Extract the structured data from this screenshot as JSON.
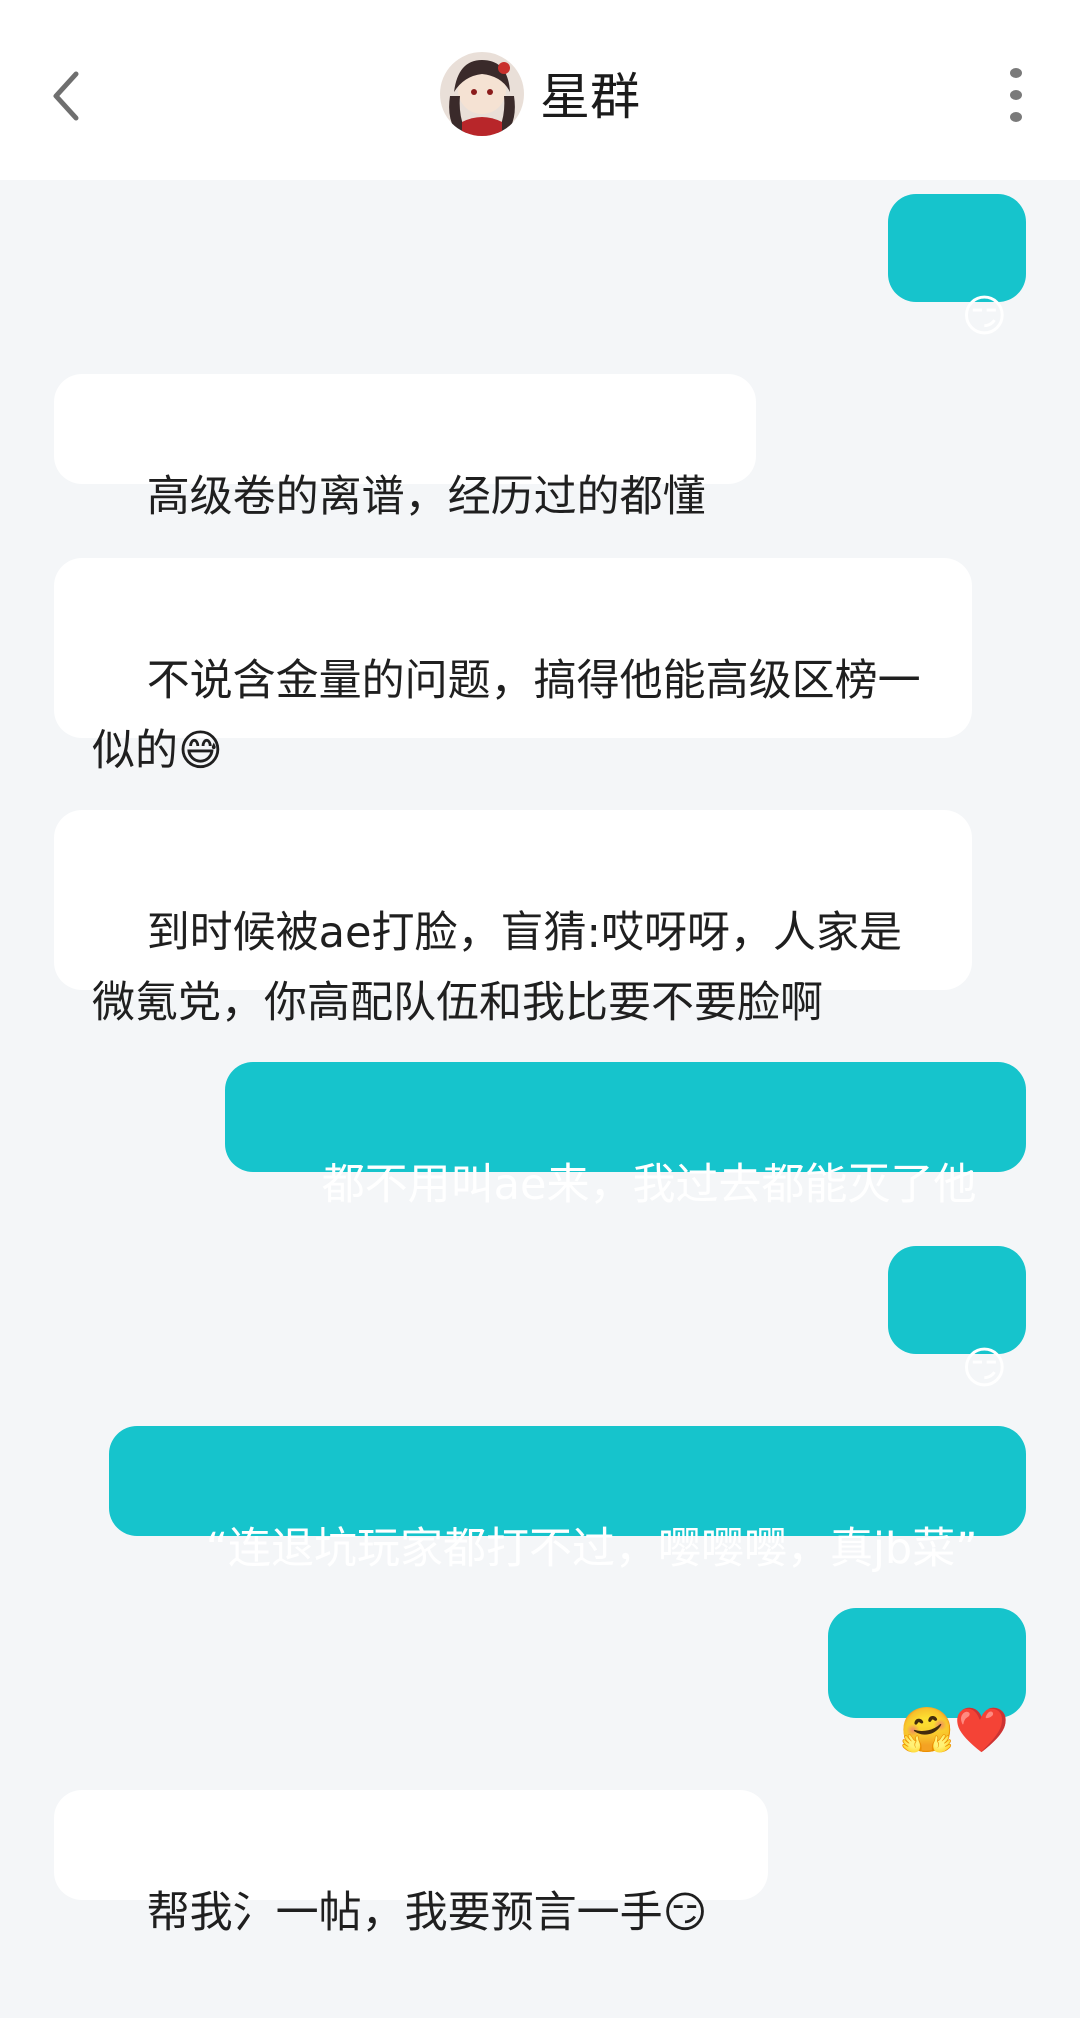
{
  "header": {
    "back_icon": "chevron-left-icon",
    "title": "星群",
    "avatar_icon": "group-avatar",
    "more_icon": "more-vertical-icon"
  },
  "messages": [
    {
      "side": "out",
      "text": "😏"
    },
    {
      "side": "in",
      "text": "高级卷的离谱，经历过的都懂"
    },
    {
      "side": "in",
      "text": "不说含金量的问题，搞得他能高级区榜一似的😅"
    },
    {
      "side": "in",
      "text": "到时候被ae打脸，盲猜:哎呀呀，人家是微氪党，你高配队伍和我比要不要脸啊"
    },
    {
      "side": "out",
      "text": "都不用叫ae来，我过去都能灭了他"
    },
    {
      "side": "out",
      "text": "😏"
    },
    {
      "side": "out",
      "text": "“连退坑玩家都打不过，嘤嘤嘤，真jb菜”"
    },
    {
      "side": "out",
      "text": "🤗❤️"
    },
    {
      "side": "in",
      "text": "帮我氵一帖，我要预言一手😏"
    }
  ],
  "colors": {
    "outgoing_bubble": "#16c4cc",
    "incoming_bubble": "#ffffff",
    "background": "#f4f6f8"
  }
}
